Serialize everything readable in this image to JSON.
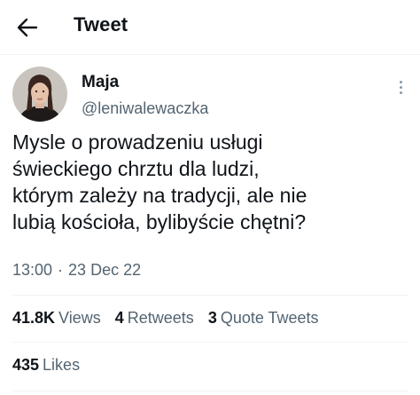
{
  "header": {
    "title": "Tweet",
    "back_icon": "arrow-left-icon"
  },
  "author": {
    "name": "Maja",
    "handle": "@leniwalewaczka",
    "avatar": "profile-photo"
  },
  "tweet": {
    "text": "Mysle o prowadzeniu usługi\nświeckiego chrztu dla ludzi,\nktórym zależy na tradycji, ale nie\nlubią kościoła, bylibyście chętni?",
    "time": "13:00",
    "separator": "·",
    "date": "23 Dec 22"
  },
  "stats": {
    "views_count": "41.8K",
    "views_label": "Views",
    "retweets_count": "4",
    "retweets_label": "Retweets",
    "quotes_count": "3",
    "quotes_label": "Quote Tweets",
    "likes_count": "435",
    "likes_label": "Likes"
  },
  "colors": {
    "text_primary": "#0f1419",
    "text_secondary": "#536471",
    "divider": "#eff3f4"
  }
}
